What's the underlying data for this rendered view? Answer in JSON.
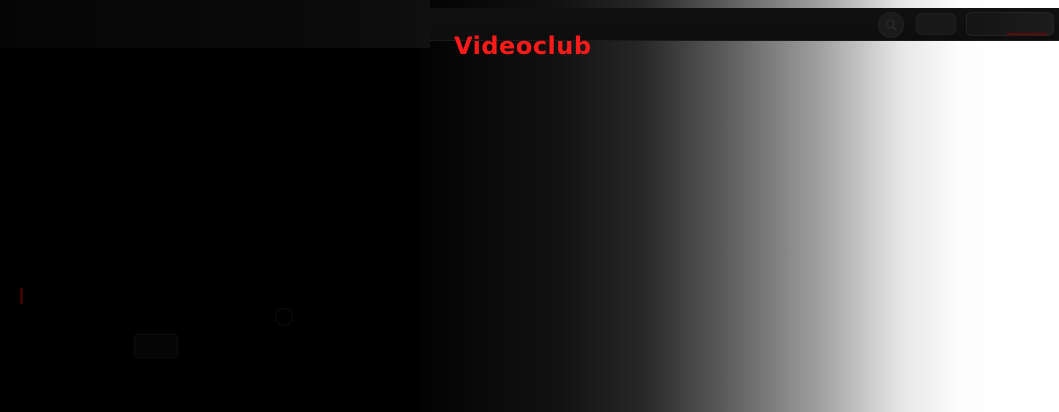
{
  "header": {
    "brand": "Videoclub",
    "search_icon": "search-icon"
  },
  "colors": {
    "brand": "#ff1a1a",
    "background": "#000000",
    "gradient_end": "#ffffff"
  }
}
